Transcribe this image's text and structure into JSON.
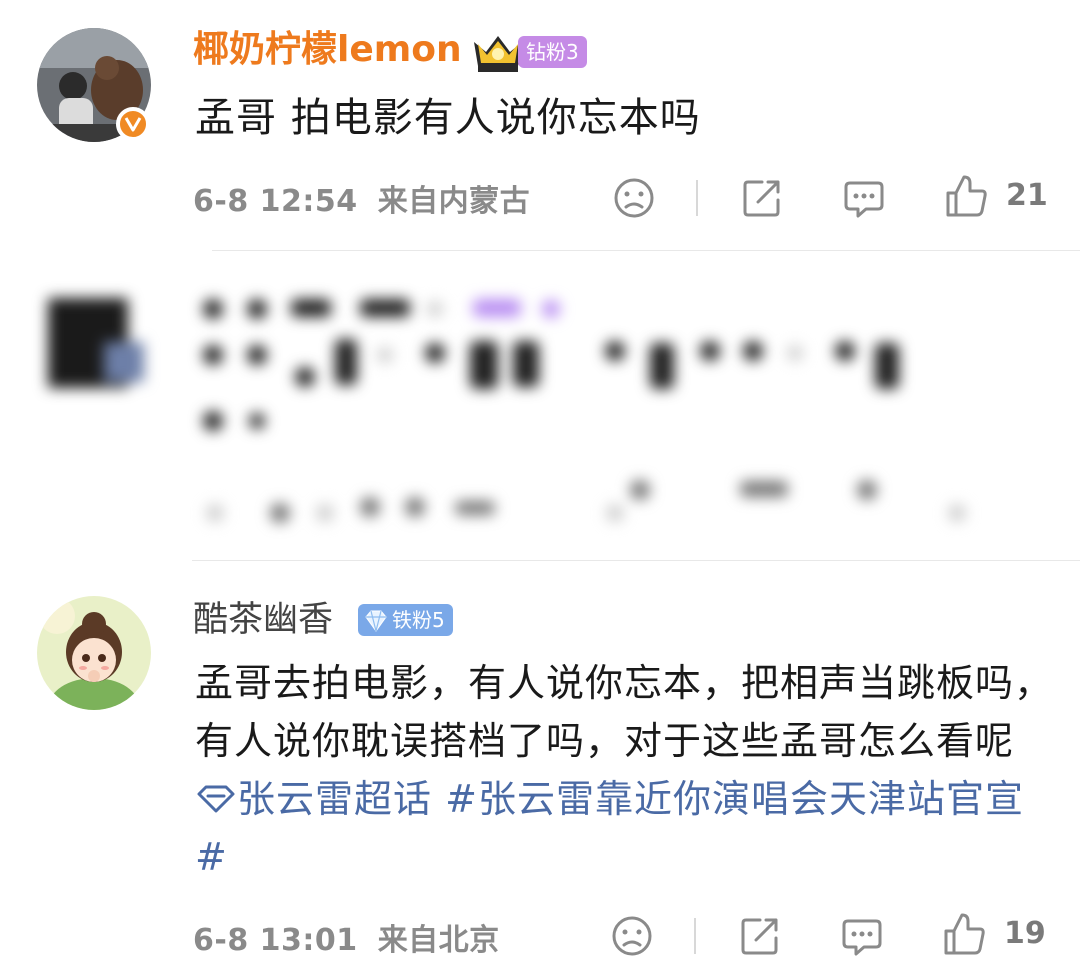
{
  "comments": [
    {
      "username": "椰奶柠檬lemon",
      "username_color": "#ee7a1d",
      "badge": "钻粉3",
      "badge_color": "#c58be6",
      "verified": true,
      "text": "孟哥 拍电影有人说你忘本吗",
      "time": "6-8 12:54",
      "location": "来自内蒙古",
      "likes": "21"
    },
    {
      "username": "酷茶幽香",
      "username_color": "#444444",
      "badge": "铁粉5",
      "badge_color": "#7aa8e8",
      "verified": false,
      "text_plain": "孟哥去拍电影，有人说你忘本，把相声当跳板吗，有人说你耽误搭档了吗，对于这些孟哥怎么看呢",
      "topic_super": "张云雷超话",
      "topic_hashtag": "#张云雷靠近你演唱会天津站官宣#",
      "time": "6-8 13:01",
      "location": "来自北京",
      "likes": "19"
    }
  ],
  "icons": [
    "sad-face-icon",
    "share-icon",
    "comment-icon",
    "like-icon",
    "crown-icon",
    "diamond-icon",
    "verified-v-icon"
  ]
}
